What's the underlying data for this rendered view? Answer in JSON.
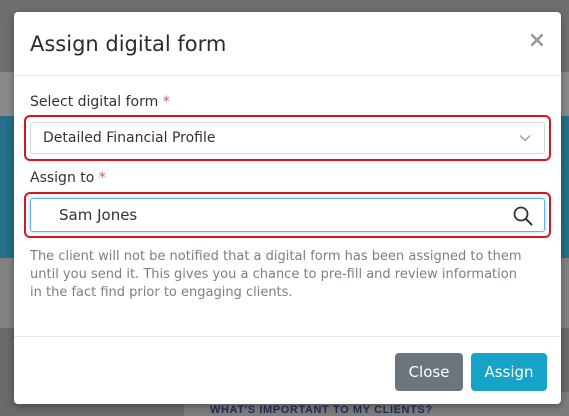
{
  "background": {
    "section_heading": "WHAT'S IMPORTANT TO MY CLIENTS?"
  },
  "modal": {
    "title": "Assign digital form",
    "close_icon": "close-icon",
    "form_field": {
      "label": "Select digital form",
      "required_marker": "*",
      "selected_value": "Detailed Financial Profile",
      "icon": "chevron-down-icon"
    },
    "assign_field": {
      "label": "Assign to",
      "required_marker": "*",
      "value": "Sam Jones",
      "icon": "search-icon"
    },
    "help_text": "The client will not be notified that a digital form has been assigned to them until you send it. This gives you a chance to pre-fill and review information in the fact find prior to engaging clients.",
    "buttons": {
      "close_label": "Close",
      "assign_label": "Assign"
    }
  },
  "colors": {
    "highlight": "#d8151c",
    "assign_button": "#17a2c8",
    "close_button": "#6c757d",
    "required": "#d9534f"
  }
}
